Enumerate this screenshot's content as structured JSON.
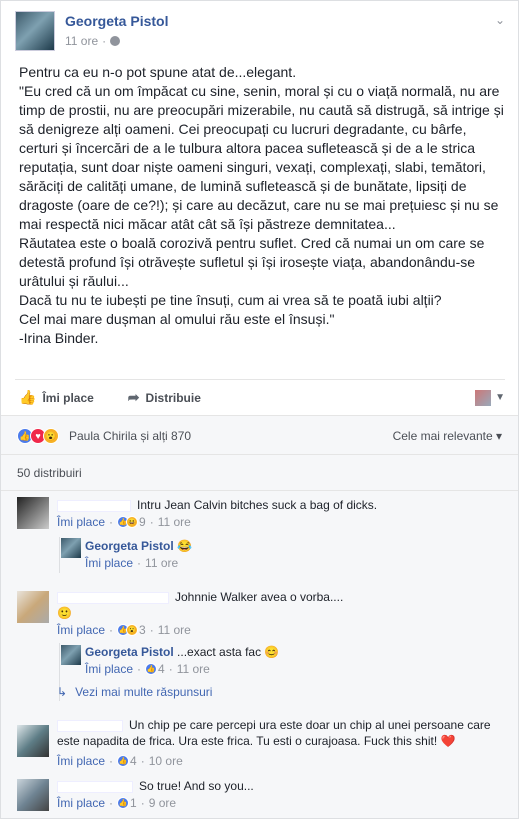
{
  "post": {
    "author": "Georgeta Pistol",
    "time": "11 ore",
    "separator": "·",
    "paragraphs": [
      "Pentru ca eu n-o pot spune atat de...elegant.",
      "\"Eu cred că un om împăcat cu sine, senin, moral și cu o viață normală, nu are timp de prostii, nu are preocupări mizerabile, nu caută să distrugă, să intrige și să denigreze alți oameni. Cei preocupați cu lucruri degradante, cu bârfe, certuri și încercări de a le tulbura altora pacea sufletească și de a le strica reputația, sunt doar niște oameni singuri, vexați, complexați, slabi, temători, sărăciți de calități umane, de lumină sufletească și de bunătate, lipsiți de dragoste (oare de ce?!); și care au decăzut, care nu se mai prețuiesc și nu se mai respectă nici măcar atât cât să își păstreze demnitatea...",
      "Răutatea este o boală corozivă pentru suflet. Cred că numai un om care se detestă profund își otrăvește sufletul și își irosește viața, abandonându-se urâtului și răului...",
      "Dacă tu nu te iubești pe tine însuți, cum ai vrea să te poată iubi alții?",
      "Cel mai mare dușman al omului rău este el însuși.\"",
      "-Irina Binder."
    ]
  },
  "actions": {
    "like": "Îmi place",
    "share": "Distribuie"
  },
  "reactions": {
    "text": "Paula Chirila și alți 870",
    "sort": "Cele mai relevante"
  },
  "shares": "50 distribuiri",
  "comments": [
    {
      "text": "Intru Jean Calvin bitches suck a bag of dicks.",
      "like": "Îmi place",
      "count": "9",
      "time": "11 ore",
      "reply": {
        "author": "Georgeta Pistol",
        "emoji": "😂",
        "like": "Îmi place",
        "time": "11 ore"
      }
    },
    {
      "text": "Johnnie Walker avea o vorba....",
      "emoji": "🙂",
      "like": "Îmi place",
      "count": "3",
      "time": "11 ore",
      "reply": {
        "author": "Georgeta Pistol",
        "text": "...exact asta fac",
        "emoji": "😊",
        "like": "Îmi place",
        "count": "4",
        "time": "11 ore"
      }
    },
    {
      "text": "Un chip pe care percepi ura este doar un chip al unei persoane care este napadita de frica. Ura este frica. Tu esti o curajoasa. Fuck this shit!",
      "emoji": "❤️",
      "like": "Îmi place",
      "count": "4",
      "time": "10 ore"
    },
    {
      "text": "So true! And so you...",
      "like": "Îmi place",
      "count": "1",
      "time": "9 ore"
    }
  ],
  "more_replies": "Vezi mai multe răspunsuri",
  "dot": "·",
  "icons": {
    "globe": "globe-icon",
    "chevron": "chevron-down-icon",
    "like": "thumbs-up-icon",
    "share": "share-arrow-icon",
    "reply_arrow": "reply-arrow-icon"
  },
  "colors": {
    "link": "#365899",
    "muted": "#90949c",
    "like_blue": "#4b7bec",
    "love_red": "#f0284a",
    "wow_yellow": "#f7b125"
  }
}
